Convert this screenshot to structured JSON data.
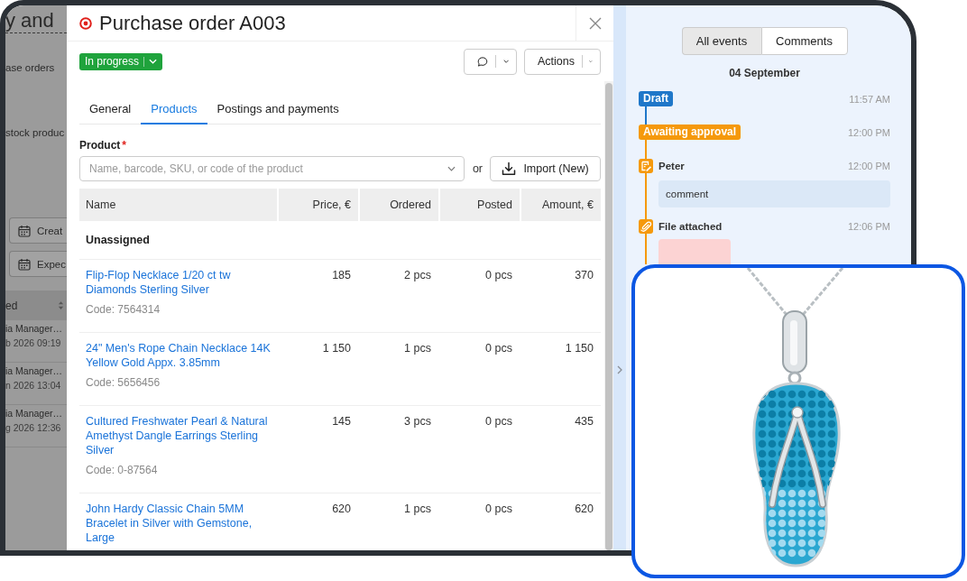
{
  "background_page": {
    "title": "y and",
    "breadcrumb": "ase orders",
    "section_label": "stock produc",
    "buttons": [
      "Creat",
      "Expec"
    ],
    "table_header": "ed",
    "rows": [
      {
        "name": "ia Manager…",
        "date": "b 2026 09:19"
      },
      {
        "name": "ia Manager…",
        "date": "n 2026 13:04"
      },
      {
        "name": "ia Manager…",
        "date": "g 2026 12:36"
      }
    ]
  },
  "order": {
    "title": "Purchase order A003",
    "status": "In progress",
    "actions_label": "Actions",
    "tabs": [
      {
        "label": "General",
        "selected": false
      },
      {
        "label": "Products",
        "selected": true
      },
      {
        "label": "Postings and payments",
        "selected": false
      }
    ],
    "product_field": {
      "label": "Product",
      "required_mark": "*",
      "placeholder": "Name, barcode, SKU, or code of the product"
    },
    "or_text": "or",
    "import_label": "Import (New)",
    "table": {
      "columns": [
        "Name",
        "Price, €",
        "Ordered",
        "Posted",
        "Amount, €"
      ],
      "group": "Unassigned",
      "rows": [
        {
          "name": "Flip-Flop Necklace 1/20 ct tw Diamonds Sterling Silver",
          "code": "Code: 7564314",
          "price": "185",
          "ordered": "2 pcs",
          "posted": "0 pcs",
          "amount": "370"
        },
        {
          "name": "24\" Men's Rope Chain Necklace 14K Yellow Gold Appx. 3.85mm",
          "code": "Code: 5656456",
          "price": "1 150",
          "ordered": "1 pcs",
          "posted": "0 pcs",
          "amount": "1 150"
        },
        {
          "name": "Cultured Freshwater Pearl & Natural Amethyst Dangle Earrings Sterling Silver",
          "code": "Code: 0-87564",
          "price": "145",
          "ordered": "3 pcs",
          "posted": "0 pcs",
          "amount": "435"
        },
        {
          "name": "John Hardy Classic Chain 5MM Bracelet in Silver with Gemstone, Large",
          "price": "620",
          "ordered": "1 pcs",
          "posted": "0 pcs",
          "amount": "620"
        }
      ]
    }
  },
  "timeline": {
    "filters": [
      {
        "label": "All events",
        "selected": true
      },
      {
        "label": "Comments",
        "selected": false
      }
    ],
    "date": "04 September",
    "events": [
      {
        "kind": "status",
        "label": "Draft",
        "color": "#1f77c9",
        "time": "11:57 AM"
      },
      {
        "kind": "status",
        "label": "Awaiting approval",
        "color": "#f5990c",
        "time": "12:00 PM"
      },
      {
        "kind": "comment",
        "author": "Peter",
        "text": "comment",
        "time": "12:00 PM"
      },
      {
        "kind": "file",
        "label": "File attached",
        "time": "12:06 PM"
      }
    ]
  }
}
